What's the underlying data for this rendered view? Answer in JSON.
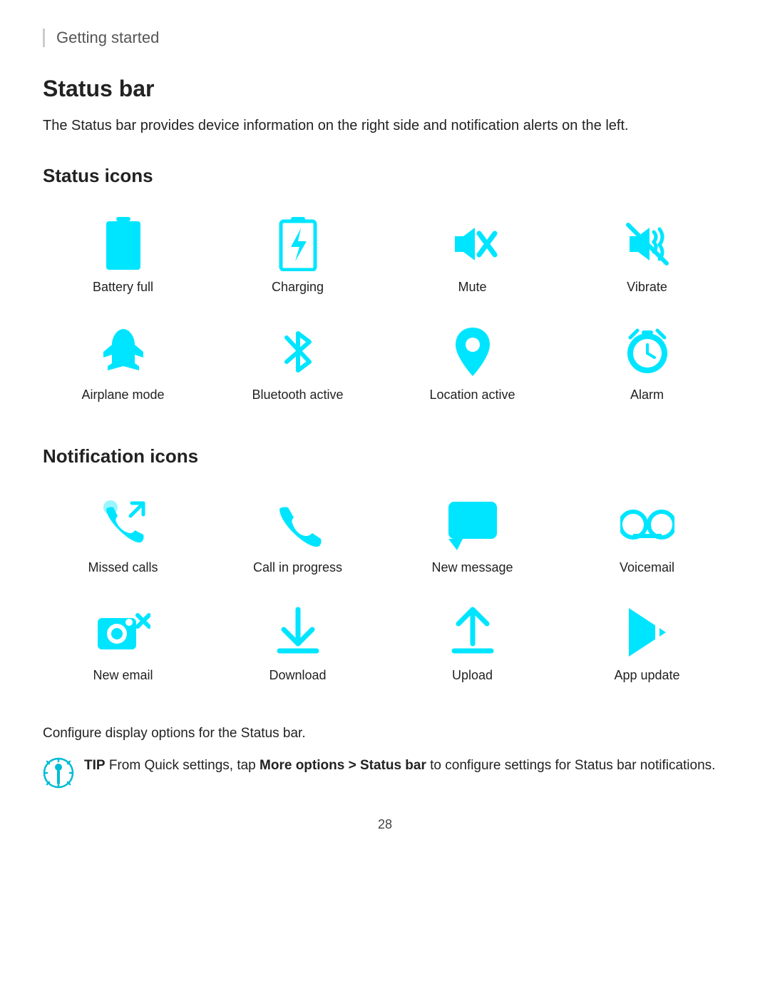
{
  "breadcrumb": {
    "label": "Getting started"
  },
  "page": {
    "title": "Status bar",
    "description": "The Status bar provides device information on the right side and notification alerts on the left.",
    "status_icons_title": "Status icons",
    "notification_icons_title": "Notification icons",
    "configure_text": "Configure display options for the Status bar.",
    "tip_label": "TIP",
    "tip_text": " From Quick settings, tap ",
    "tip_bold": "More options > Status bar",
    "tip_end": " to configure settings for Status bar notifications.",
    "page_number": "28"
  },
  "status_icons": [
    {
      "label": "Battery full",
      "icon": "battery-full"
    },
    {
      "label": "Charging",
      "icon": "charging"
    },
    {
      "label": "Mute",
      "icon": "mute"
    },
    {
      "label": "Vibrate",
      "icon": "vibrate"
    },
    {
      "label": "Airplane mode",
      "icon": "airplane"
    },
    {
      "label": "Bluetooth active",
      "icon": "bluetooth"
    },
    {
      "label": "Location active",
      "icon": "location"
    },
    {
      "label": "Alarm",
      "icon": "alarm"
    }
  ],
  "notification_icons": [
    {
      "label": "Missed calls",
      "icon": "missed-calls"
    },
    {
      "label": "Call in progress",
      "icon": "call-progress"
    },
    {
      "label": "New message",
      "icon": "new-message"
    },
    {
      "label": "Voicemail",
      "icon": "voicemail"
    },
    {
      "label": "New email",
      "icon": "new-email"
    },
    {
      "label": "Download",
      "icon": "download"
    },
    {
      "label": "Upload",
      "icon": "upload"
    },
    {
      "label": "App update",
      "icon": "app-update"
    }
  ]
}
